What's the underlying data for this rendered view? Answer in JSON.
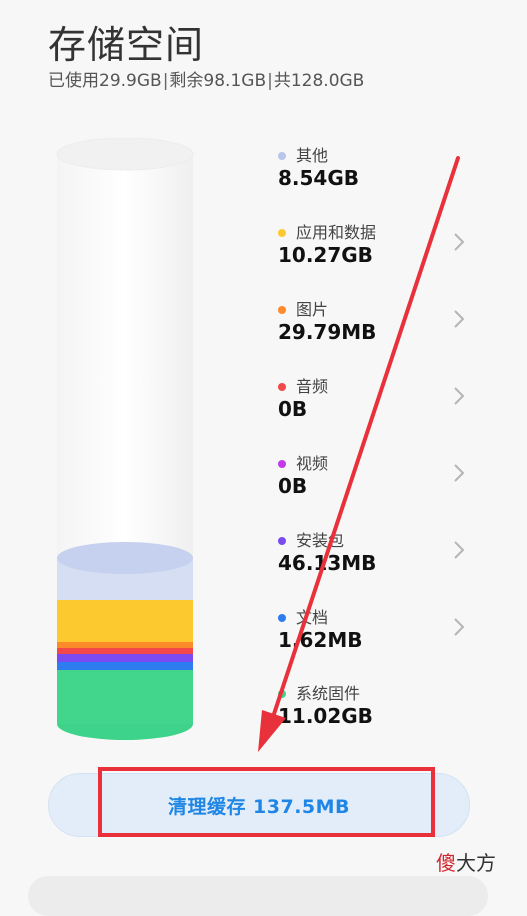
{
  "header": {
    "title": "存储空间",
    "used": "已使用29.9GB",
    "remaining": "剩余98.1GB",
    "total": "共128.0GB",
    "separator": "|"
  },
  "categories": [
    {
      "label": "其他",
      "value": "8.54GB",
      "color": "#b8c6ea",
      "has_chevron": false
    },
    {
      "label": "应用和数据",
      "value": "10.27GB",
      "color": "#fcc92f",
      "has_chevron": true
    },
    {
      "label": "图片",
      "value": "29.79MB",
      "color": "#ff8a2a",
      "has_chevron": true
    },
    {
      "label": "音频",
      "value": "0B",
      "color": "#f24848",
      "has_chevron": true
    },
    {
      "label": "视频",
      "value": "0B",
      "color": "#c338e8",
      "has_chevron": true
    },
    {
      "label": "安装包",
      "value": "46.13MB",
      "color": "#7a4bf0",
      "has_chevron": true
    },
    {
      "label": "文档",
      "value": "1.62MB",
      "color": "#2f7cf0",
      "has_chevron": true
    },
    {
      "label": "系统固件",
      "value": "11.02GB",
      "color": "#3ed38a",
      "has_chevron": false
    }
  ],
  "clean_button": {
    "label": "清理缓存 137.5MB"
  },
  "watermark": {
    "first": "傻",
    "rest": "大方"
  },
  "icons": {
    "chevron": "chevron-right-icon",
    "arrow": "red-annotation-arrow"
  },
  "colors": {
    "accent": "#1f86e5",
    "annotation": "#e8313a"
  }
}
